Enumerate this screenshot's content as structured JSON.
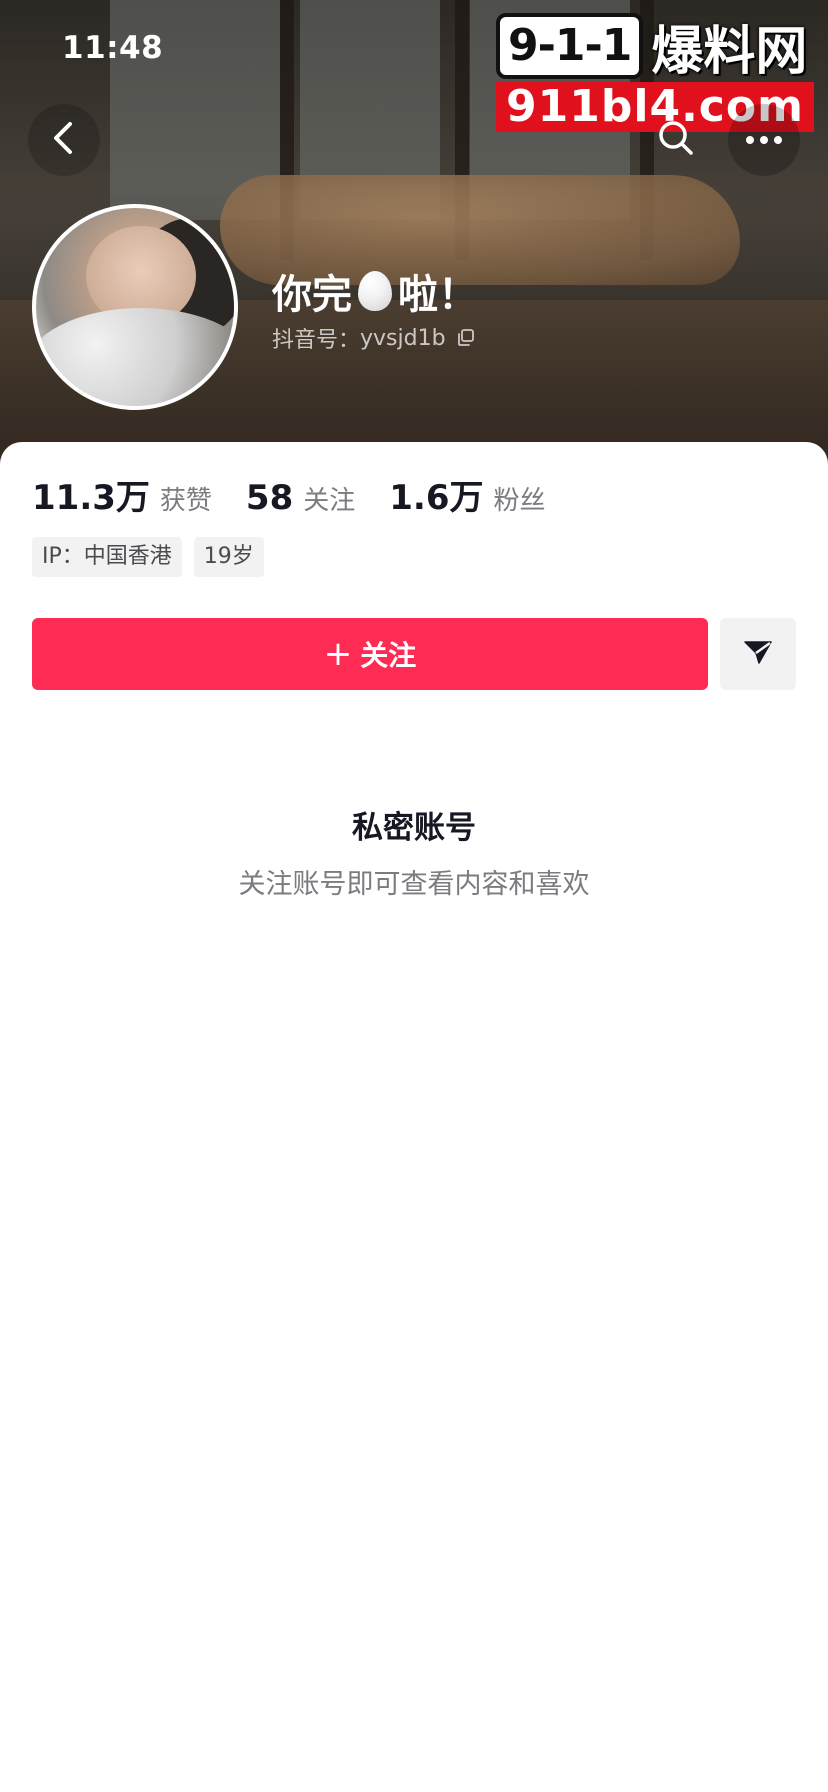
{
  "status_bar": {
    "time": "11:48"
  },
  "watermark": {
    "badge": "9-1-1",
    "name": "爆料网",
    "domain": "911bl4.com"
  },
  "header": {
    "back_icon": "chevron-left-icon",
    "search_icon": "search-icon",
    "more_icon": "more-dots-icon"
  },
  "profile": {
    "nickname_before": "你完",
    "nickname_emoji": "egg",
    "nickname_after": "啦！",
    "id_label": "抖音号：",
    "id_value": "yvsjd1b"
  },
  "stats": [
    {
      "value": "11.3万",
      "label": "获赞"
    },
    {
      "value": "58",
      "label": "关注"
    },
    {
      "value": "1.6万",
      "label": "粉丝"
    }
  ],
  "tags": [
    "IP：中国香港",
    "19岁"
  ],
  "actions": {
    "follow_plus": "+",
    "follow_label": "关注",
    "share_icon": "send-icon",
    "accent_color": "#fe2c55"
  },
  "private": {
    "title": "私密账号",
    "subtitle": "关注账号即可查看内容和喜欢"
  }
}
